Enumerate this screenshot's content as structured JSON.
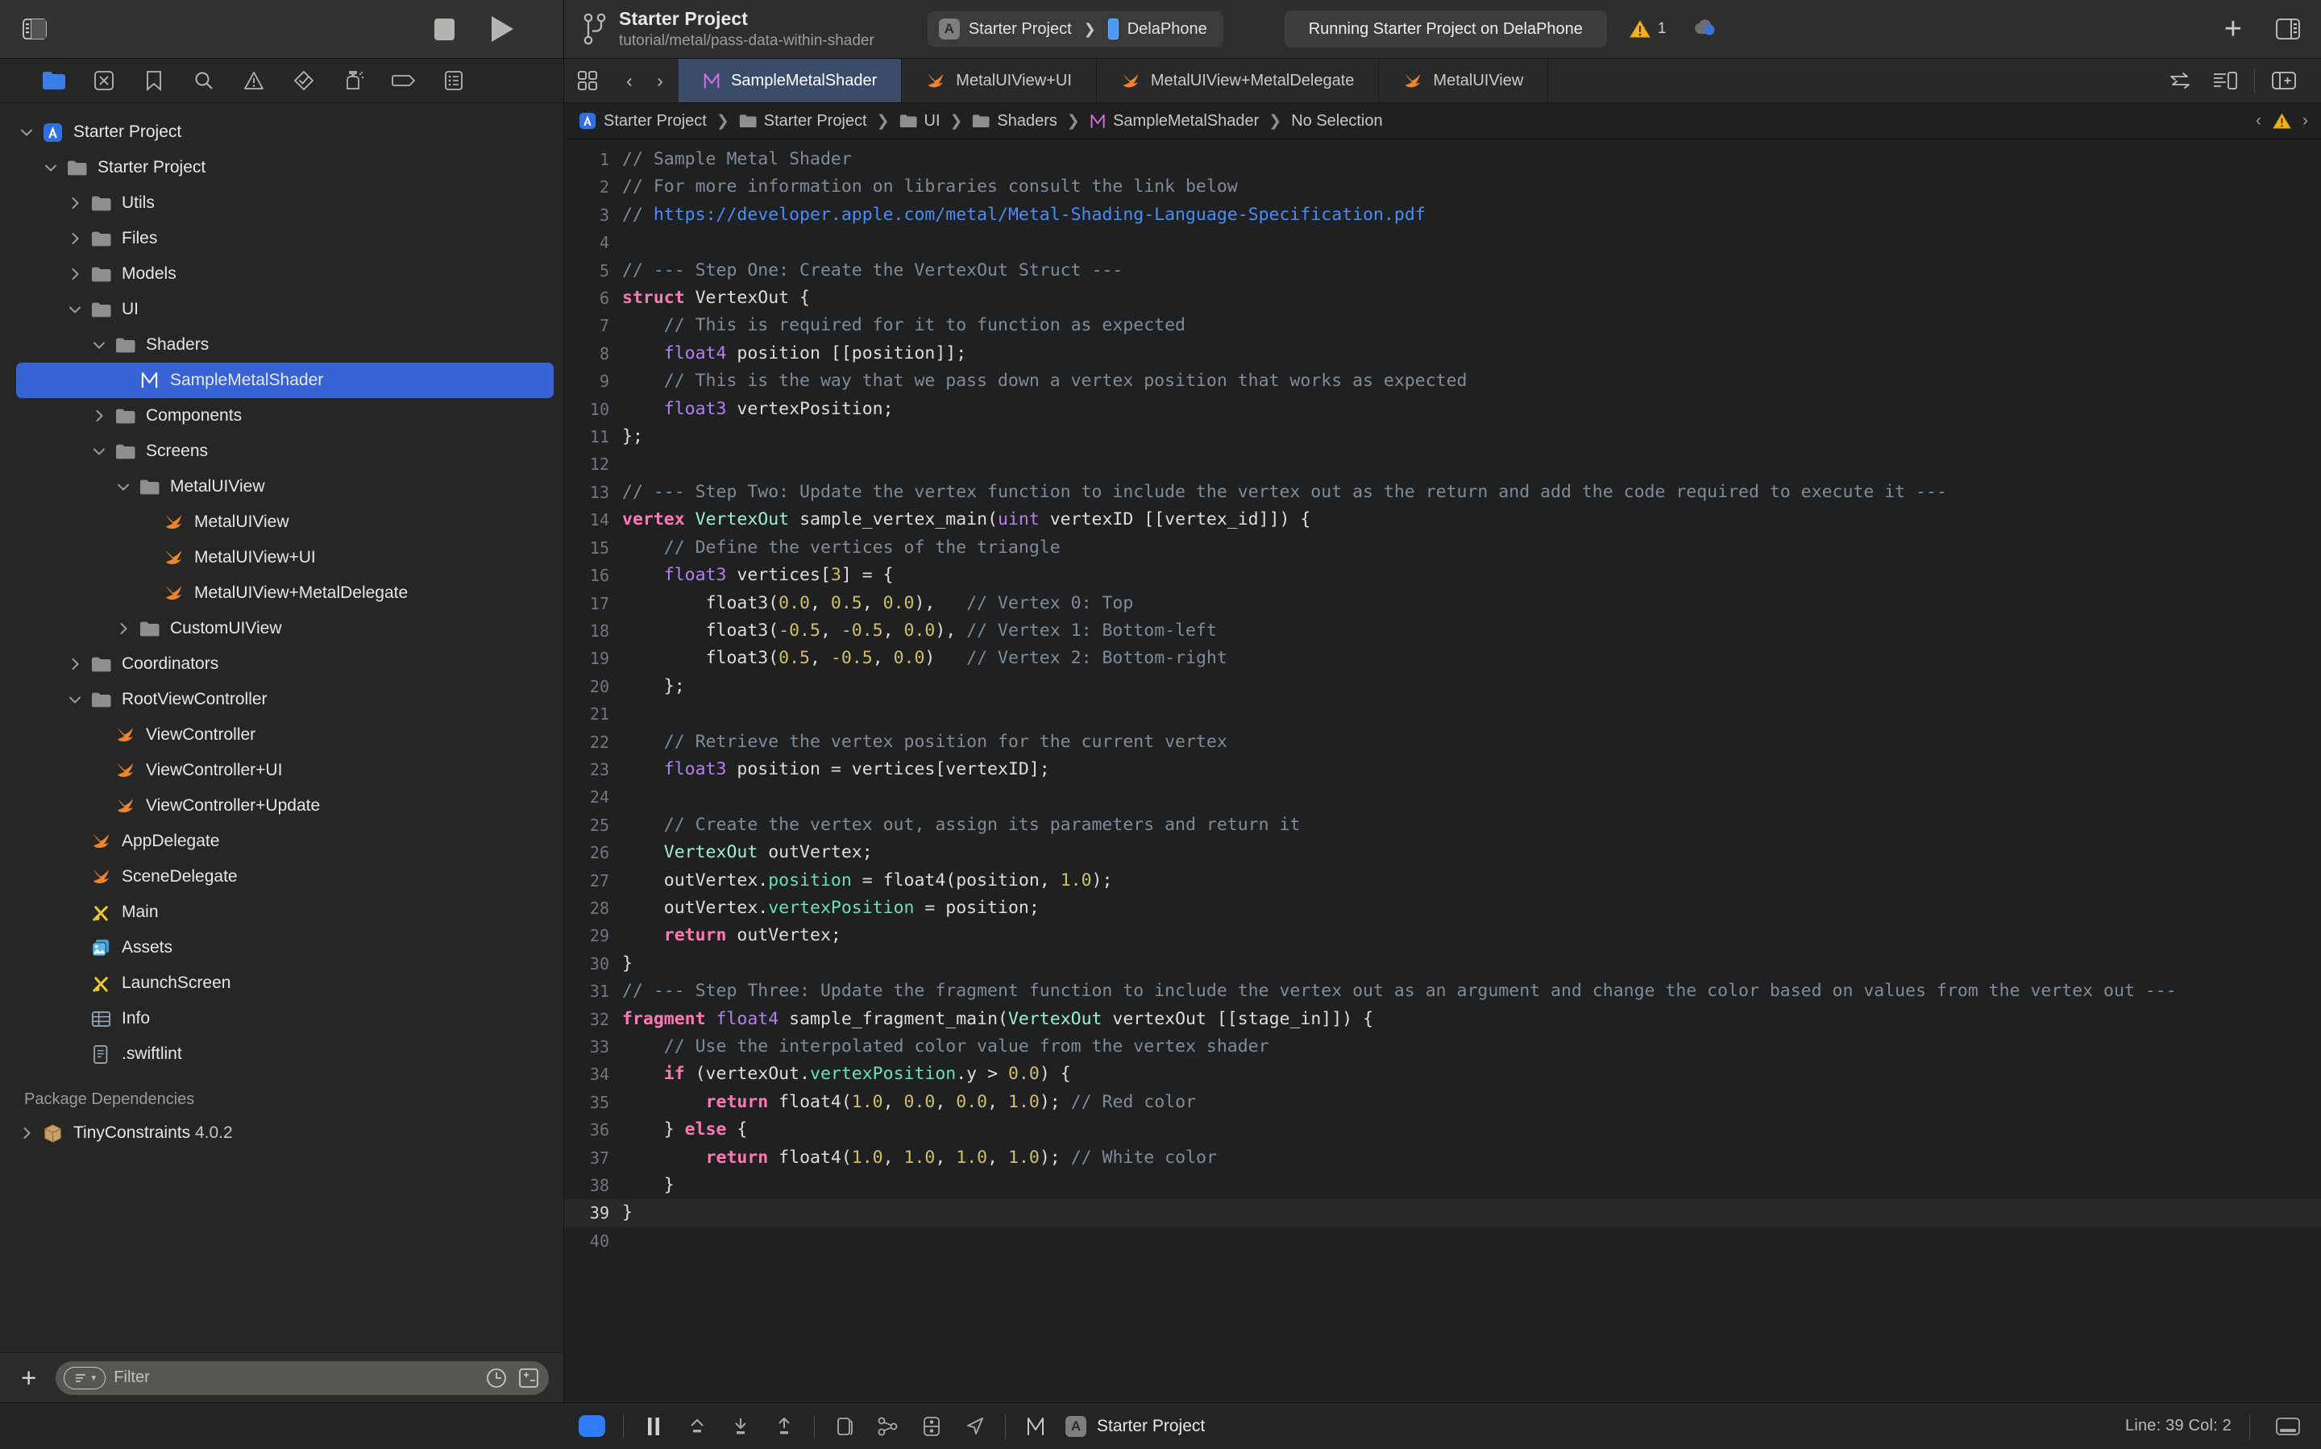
{
  "toolbar": {
    "sidebar_toggle_icon": "sidebar-left-icon",
    "stop_button_label": "Stop",
    "run_button_label": "Run",
    "scheme_branch_icon": "source-control-branch-icon",
    "project_title": "Starter Project",
    "project_subtitle": "tutorial/metal/pass-data-within-shader",
    "scheme_app_badge": "A",
    "scheme_name": "Starter Project",
    "scheme_separator": "❯",
    "destination_name": "DelaPhone",
    "status_text": "Running Starter Project on DelaPhone",
    "warning_icon": "warning-triangle-icon",
    "warning_count": "1",
    "account_icon": "cloud-account-icon",
    "add_button_label": "+",
    "inspector_toggle_icon": "sidebar-right-icon"
  },
  "navigator": {
    "tabs": [
      {
        "name": "project-navigator",
        "icon": "folder-icon",
        "active": true
      },
      {
        "name": "source-control-navigator",
        "icon": "source-control-icon",
        "active": false
      },
      {
        "name": "bookmark-navigator",
        "icon": "bookmark-icon",
        "active": false
      },
      {
        "name": "find-navigator",
        "icon": "search-icon",
        "active": false
      },
      {
        "name": "issue-navigator",
        "icon": "warning-triangle-icon",
        "active": false
      },
      {
        "name": "test-navigator",
        "icon": "diamond-check-icon",
        "active": false
      },
      {
        "name": "debug-navigator",
        "icon": "spray-icon",
        "active": false
      },
      {
        "name": "breakpoint-navigator",
        "icon": "tag-icon",
        "active": false
      },
      {
        "name": "report-navigator",
        "icon": "report-list-icon",
        "active": false
      }
    ],
    "tree": [
      {
        "label": "Starter Project",
        "depth": 0,
        "icon": "xcode-project-icon",
        "twisty": "down",
        "selected": false
      },
      {
        "label": "Starter Project",
        "depth": 1,
        "icon": "folder-icon",
        "twisty": "down",
        "selected": false
      },
      {
        "label": "Utils",
        "depth": 2,
        "icon": "folder-icon",
        "twisty": "right",
        "selected": false
      },
      {
        "label": "Files",
        "depth": 2,
        "icon": "folder-icon",
        "twisty": "right",
        "selected": false
      },
      {
        "label": "Models",
        "depth": 2,
        "icon": "folder-icon",
        "twisty": "right",
        "selected": false
      },
      {
        "label": "UI",
        "depth": 2,
        "icon": "folder-icon",
        "twisty": "down",
        "selected": false
      },
      {
        "label": "Shaders",
        "depth": 3,
        "icon": "folder-icon",
        "twisty": "down",
        "selected": false
      },
      {
        "label": "SampleMetalShader",
        "depth": 4,
        "icon": "metal-file-icon",
        "twisty": "none",
        "selected": true
      },
      {
        "label": "Components",
        "depth": 3,
        "icon": "folder-icon",
        "twisty": "right",
        "selected": false
      },
      {
        "label": "Screens",
        "depth": 3,
        "icon": "folder-icon",
        "twisty": "down",
        "selected": false
      },
      {
        "label": "MetalUIView",
        "depth": 4,
        "icon": "folder-icon",
        "twisty": "down",
        "selected": false
      },
      {
        "label": "MetalUIView",
        "depth": 5,
        "icon": "swift-file-icon",
        "twisty": "none",
        "selected": false
      },
      {
        "label": "MetalUIView+UI",
        "depth": 5,
        "icon": "swift-file-icon",
        "twisty": "none",
        "selected": false
      },
      {
        "label": "MetalUIView+MetalDelegate",
        "depth": 5,
        "icon": "swift-file-icon",
        "twisty": "none",
        "selected": false
      },
      {
        "label": "CustomUIView",
        "depth": 4,
        "icon": "folder-icon",
        "twisty": "right",
        "selected": false
      },
      {
        "label": "Coordinators",
        "depth": 2,
        "icon": "folder-icon",
        "twisty": "right",
        "selected": false
      },
      {
        "label": "RootViewController",
        "depth": 2,
        "icon": "folder-icon",
        "twisty": "down",
        "selected": false
      },
      {
        "label": "ViewController",
        "depth": 3,
        "icon": "swift-file-icon",
        "twisty": "none",
        "selected": false
      },
      {
        "label": "ViewController+UI",
        "depth": 3,
        "icon": "swift-file-icon",
        "twisty": "none",
        "selected": false
      },
      {
        "label": "ViewController+Update",
        "depth": 3,
        "icon": "swift-file-icon",
        "twisty": "none",
        "selected": false
      },
      {
        "label": "AppDelegate",
        "depth": 2,
        "icon": "swift-file-icon",
        "twisty": "none",
        "selected": false
      },
      {
        "label": "SceneDelegate",
        "depth": 2,
        "icon": "swift-file-icon",
        "twisty": "none",
        "selected": false
      },
      {
        "label": "Main",
        "depth": 2,
        "icon": "storyboard-icon",
        "twisty": "none",
        "selected": false
      },
      {
        "label": "Assets",
        "depth": 2,
        "icon": "assets-icon",
        "twisty": "none",
        "selected": false
      },
      {
        "label": "LaunchScreen",
        "depth": 2,
        "icon": "storyboard-icon",
        "twisty": "none",
        "selected": false
      },
      {
        "label": "Info",
        "depth": 2,
        "icon": "plist-icon",
        "twisty": "none",
        "selected": false
      },
      {
        "label": ".swiftlint",
        "depth": 2,
        "icon": "text-file-icon",
        "twisty": "none",
        "selected": false
      }
    ],
    "section_header": "Package Dependencies",
    "packages": [
      {
        "label": "TinyConstraints",
        "version": "4.0.2",
        "icon": "package-icon",
        "twisty": "right"
      }
    ],
    "filter": {
      "add_label": "+",
      "filter_icon": "filter-lines-icon",
      "chevron_icon": "chevron-down-icon",
      "placeholder": "Filter",
      "recent_icon": "clock-icon",
      "modified_icon": "plus-minus-icon"
    }
  },
  "editor": {
    "grid_icon": "editor-grid-icon",
    "back_label": "‹",
    "forward_label": "›",
    "tabs": [
      {
        "label": "SampleMetalShader",
        "icon": "metal-file-icon",
        "active": true
      },
      {
        "label": "MetalUIView+UI",
        "icon": "swift-file-icon",
        "active": false
      },
      {
        "label": "MetalUIView+MetalDelegate",
        "icon": "swift-file-icon",
        "active": false
      },
      {
        "label": "MetalUIView",
        "icon": "swift-file-icon",
        "active": false
      }
    ],
    "right_icons": [
      {
        "name": "adjust-editor-icon"
      },
      {
        "name": "minimap-icon"
      },
      {
        "name": "add-editor-icon"
      }
    ],
    "breadcrumb": [
      {
        "label": "Starter Project",
        "icon": "xcode-project-icon"
      },
      {
        "label": "Starter Project",
        "icon": "folder-icon"
      },
      {
        "label": "UI",
        "icon": "folder-icon"
      },
      {
        "label": "Shaders",
        "icon": "folder-icon"
      },
      {
        "label": "SampleMetalShader",
        "icon": "metal-file-icon"
      },
      {
        "label": "No Selection",
        "icon": "none"
      }
    ],
    "breadcrumb_separator": "❯",
    "issue_prev_label": "‹",
    "issue_warning_icon": "warning-triangle-icon",
    "issue_next_label": "›"
  },
  "code": {
    "current_line": 39,
    "lines": [
      {
        "n": 1,
        "html": "<span class='cm'>// Sample Metal Shader</span>"
      },
      {
        "n": 2,
        "html": "<span class='cm'>// For more information on libraries consult the link below</span>"
      },
      {
        "n": 3,
        "html": "<span class='cm'>// </span><span class='lnk'>https://developer.apple.com/metal/Metal-Shading-Language-Specification.pdf</span>"
      },
      {
        "n": 4,
        "html": ""
      },
      {
        "n": 5,
        "html": "<span class='cm'>// --- Step One: Create the VertexOut Struct ---</span>"
      },
      {
        "n": 6,
        "html": "<span class='kw'>struct</span> VertexOut {"
      },
      {
        "n": 7,
        "html": "    <span class='cm'>// This is required for it to function as expected</span>"
      },
      {
        "n": 8,
        "html": "    <span class='bty'>float4</span> position [[position]];"
      },
      {
        "n": 9,
        "html": "    <span class='cm'>// This is the way that we pass down a vertex position that works as expected</span>"
      },
      {
        "n": 10,
        "html": "    <span class='bty'>float3</span> vertexPosition;"
      },
      {
        "n": 11,
        "html": "};"
      },
      {
        "n": 12,
        "html": ""
      },
      {
        "n": 13,
        "html": "<span class='cm'>// --- Step Two: Update the vertex function to include the vertex out as the return and add the code required to execute it ---</span>"
      },
      {
        "n": 14,
        "html": "<span class='kw'>vertex</span> <span class='ty'>VertexOut</span> sample_vertex_main(<span class='bty'>uint</span> vertexID [[vertex_id]]) {"
      },
      {
        "n": 15,
        "html": "    <span class='cm'>// Define the vertices of the triangle</span>"
      },
      {
        "n": 16,
        "html": "    <span class='bty'>float3</span> vertices[<span class='num'>3</span>] = {"
      },
      {
        "n": 17,
        "html": "        float3(<span class='num'>0.0</span>, <span class='num'>0.5</span>, <span class='num'>0.0</span>),   <span class='cm'>// Vertex 0: Top</span>"
      },
      {
        "n": 18,
        "html": "        float3(<span class='num'>-0.5</span>, <span class='num'>-0.5</span>, <span class='num'>0.0</span>), <span class='cm'>// Vertex 1: Bottom-left</span>"
      },
      {
        "n": 19,
        "html": "        float3(<span class='num'>0.5</span>, <span class='num'>-0.5</span>, <span class='num'>0.0</span>)   <span class='cm'>// Vertex 2: Bottom-right</span>"
      },
      {
        "n": 20,
        "html": "    };"
      },
      {
        "n": 21,
        "html": ""
      },
      {
        "n": 22,
        "html": "    <span class='cm'>// Retrieve the vertex position for the current vertex</span>"
      },
      {
        "n": 23,
        "html": "    <span class='bty'>float3</span> position = vertices[vertexID];"
      },
      {
        "n": 24,
        "html": ""
      },
      {
        "n": 25,
        "html": "    <span class='cm'>// Create the vertex out, assign its parameters and return it</span>"
      },
      {
        "n": 26,
        "html": "    <span class='ty'>VertexOut</span> outVertex;"
      },
      {
        "n": 27,
        "html": "    outVertex.<span class='prop'>position</span> = float4(position, <span class='num'>1.0</span>);"
      },
      {
        "n": 28,
        "html": "    outVertex.<span class='prop'>vertexPosition</span> = position;"
      },
      {
        "n": 29,
        "html": "    <span class='kw'>return</span> outVertex;"
      },
      {
        "n": 30,
        "html": "}"
      },
      {
        "n": 31,
        "html": "<span class='cm'>// --- Step Three: Update the fragment function to include the vertex out as an argument and change the color based on values from the vertex out ---</span>"
      },
      {
        "n": 32,
        "html": "<span class='kw'>fragment</span> <span class='bty'>float4</span> sample_fragment_main(<span class='ty'>VertexOut</span> vertexOut [[stage_in]]) {"
      },
      {
        "n": 33,
        "html": "    <span class='cm'>// Use the interpolated color value from the vertex shader</span>"
      },
      {
        "n": 34,
        "html": "    <span class='kw'>if</span> (vertexOut.<span class='prop'>vertexPosition</span>.y > <span class='num'>0.0</span>) {"
      },
      {
        "n": 35,
        "html": "        <span class='kw'>return</span> float4(<span class='num'>1.0</span>, <span class='num'>0.0</span>, <span class='num'>0.0</span>, <span class='num'>1.0</span>); <span class='cm'>// Red color</span>"
      },
      {
        "n": 36,
        "html": "    } <span class='kw'>else</span> {"
      },
      {
        "n": 37,
        "html": "        <span class='kw'>return</span> float4(<span class='num'>1.0</span>, <span class='num'>1.0</span>, <span class='num'>1.0</span>, <span class='num'>1.0</span>); <span class='cm'>// White color</span>"
      },
      {
        "n": 38,
        "html": "    }"
      },
      {
        "n": 39,
        "html": "}"
      },
      {
        "n": 40,
        "html": ""
      }
    ]
  },
  "bottom_bar": {
    "run_indicator": "run-indicator",
    "controls": [
      {
        "name": "pause-button",
        "icon": "pause-icon"
      },
      {
        "name": "step-over-button",
        "icon": "step-over-icon"
      },
      {
        "name": "step-into-button",
        "icon": "step-into-icon"
      },
      {
        "name": "step-out-button",
        "icon": "step-out-icon"
      },
      {
        "name": "view-hierarchy-button",
        "icon": "layers-icon"
      },
      {
        "name": "memory-graph-button",
        "icon": "memory-graph-icon"
      },
      {
        "name": "environment-overrides-button",
        "icon": "environment-icon"
      },
      {
        "name": "location-simulate-button",
        "icon": "location-icon"
      },
      {
        "name": "metal-debug-button",
        "icon": "metal-file-icon"
      }
    ],
    "process_badge": "A",
    "process_name": "Starter Project",
    "line_col": "Line: 39  Col: 2",
    "console_toggle_icon": "console-toggle-icon"
  },
  "colors": {
    "accent_blue": "#3664d4",
    "tab_active_blue": "#3a4c6a",
    "swift_orange": "#f0832d",
    "metal_magenta": "#d66ee0",
    "warning_yellow": "#f2b01e",
    "run_blue": "#2f7cf6"
  }
}
